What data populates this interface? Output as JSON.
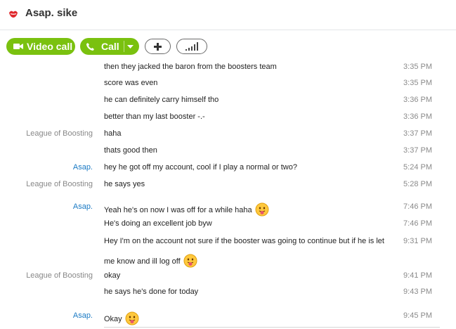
{
  "header": {
    "title": "Asap. sike",
    "status_icon": "red-lips-status-icon"
  },
  "toolbar": {
    "video_call_label": "Video call",
    "call_label": "Call",
    "add_icon": "plus-icon",
    "signal_icon": "signal-bars-icon"
  },
  "colors": {
    "accent_green": "#7ac10f",
    "sender_blue": "#1a7ac4",
    "sender_gray": "#888888"
  },
  "messages": [
    {
      "sender": "",
      "text": "then they jacked the baron from the boosters team",
      "time": "3:35 PM"
    },
    {
      "sender": "",
      "text": "score was even",
      "time": "3:35 PM"
    },
    {
      "sender": "",
      "text": "he can definitely carry himself tho",
      "time": "3:36 PM"
    },
    {
      "sender": "",
      "text": "better than my last booster -.-",
      "time": "3:36 PM"
    },
    {
      "sender": "League of Boosting",
      "text": "haha",
      "time": "3:37 PM"
    },
    {
      "sender": "",
      "text": "thats good then",
      "time": "3:37 PM"
    },
    {
      "sender": "Asap.",
      "text": "hey he got off my account, cool if I play a normal or two?",
      "time": "5:24 PM"
    },
    {
      "sender": "League of Boosting",
      "text": "he says yes",
      "time": "5:28 PM"
    },
    {
      "sender": "Asap.",
      "text": "Yeah he's on now I was off for a while haha",
      "time": "7:46 PM",
      "emoticon": "tongue-out-emoticon-icon"
    },
    {
      "sender": "",
      "text": "He's doing an excellent job byw",
      "time": "7:46 PM"
    },
    {
      "sender": "",
      "text": "Hey I'm on the account not sure if the booster was going to continue but if he is let",
      "time": "9:31 PM"
    },
    {
      "sender": "",
      "text": "me know and ill log off",
      "time": "",
      "emoticon": "tongue-out-emoticon-icon"
    },
    {
      "sender": "League of Boosting",
      "text": "okay",
      "time": "9:41 PM"
    },
    {
      "sender": "",
      "text": "he says he's done for today",
      "time": "9:43 PM"
    },
    {
      "sender": "Asap.",
      "text": "Okay",
      "time": "9:45 PM",
      "emoticon": "tongue-out-emoticon-icon"
    }
  ]
}
